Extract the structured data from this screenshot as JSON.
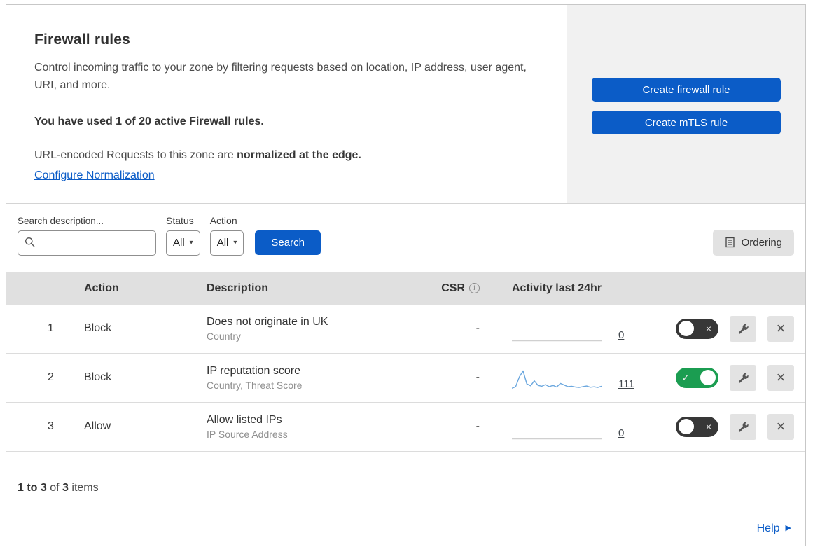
{
  "colors": {
    "accent": "#0b5cc7",
    "toggle_green": "#1b9d51",
    "spark_blue": "#6ba7de",
    "spark_gray": "#d0d0d0"
  },
  "header": {
    "title": "Firewall rules",
    "description": "Control incoming traffic to your zone by filtering requests based on location, IP address, user agent, URI, and more.",
    "usage_note": "You have used 1 of 20 active Firewall rules.",
    "normalization_prefix": "URL-encoded Requests to this zone are ",
    "normalization_bold": "normalized at the edge.",
    "configure_link": "Configure Normalization",
    "buttons": {
      "create_firewall": "Create firewall rule",
      "create_mtls": "Create mTLS rule"
    }
  },
  "filters": {
    "search_label": "Search description...",
    "status_label": "Status",
    "status_value": "All",
    "action_label": "Action",
    "action_value": "All",
    "search_button": "Search",
    "ordering_button": "Ordering"
  },
  "table": {
    "headers": {
      "action": "Action",
      "description": "Description",
      "csr": "CSR",
      "activity": "Activity last 24hr"
    },
    "rows": [
      {
        "num": "1",
        "action": "Block",
        "description": "Does not originate in UK",
        "criteria": "Country",
        "csr": "-",
        "count": "0",
        "enabled": false,
        "sparkline": [
          0,
          0,
          0,
          0,
          0,
          0,
          0,
          0,
          0,
          0,
          0,
          0,
          0,
          0,
          0,
          0,
          0,
          0,
          0,
          0
        ]
      },
      {
        "num": "2",
        "action": "Block",
        "description": "IP reputation score",
        "criteria": "Country, Threat Score",
        "csr": "-",
        "count": "111",
        "enabled": true,
        "sparkline": [
          0.8,
          1.5,
          6.5,
          9.5,
          3,
          2,
          4.5,
          2.2,
          1.8,
          2.6,
          1.6,
          2.2,
          1.4,
          3.2,
          2.4,
          1.6,
          1.8,
          1.4,
          1.2,
          1.6,
          1.9,
          1.3,
          1.5,
          1.2,
          1.8
        ]
      },
      {
        "num": "3",
        "action": "Allow",
        "description": "Allow listed IPs",
        "criteria": "IP Source Address",
        "csr": "-",
        "count": "0",
        "enabled": false,
        "sparkline": [
          0,
          0,
          0,
          0,
          0,
          0,
          0,
          0,
          0,
          0,
          0,
          0,
          0,
          0,
          0,
          0,
          0,
          0,
          0,
          0
        ]
      }
    ]
  },
  "footer": {
    "range": "1 to 3",
    "of": " of ",
    "total": "3",
    "items": " items"
  },
  "help": {
    "label": "Help"
  }
}
